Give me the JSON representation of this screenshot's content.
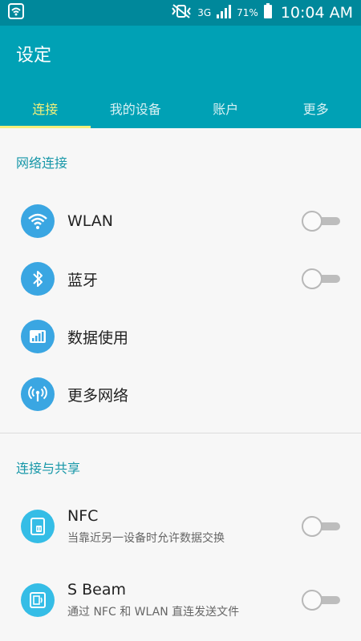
{
  "status_bar": {
    "network": "3G",
    "battery": "71%",
    "time": "10:04 AM"
  },
  "app": {
    "title": "设定",
    "accent": "#00a1b5",
    "tab_indicator": "#f3f07a"
  },
  "tabs": [
    {
      "label": "连接",
      "active": true
    },
    {
      "label": "我的设备",
      "active": false
    },
    {
      "label": "账户",
      "active": false
    },
    {
      "label": "更多",
      "active": false
    }
  ],
  "sections": [
    {
      "header": "网络连接",
      "items": [
        {
          "title": "WLAN",
          "icon": "wifi-icon",
          "toggle": false
        },
        {
          "title": "蓝牙",
          "icon": "bluetooth-icon",
          "toggle": false
        },
        {
          "title": "数据使用",
          "icon": "data-usage-icon"
        },
        {
          "title": "更多网络",
          "icon": "more-networks-icon"
        }
      ]
    },
    {
      "header": "连接与共享",
      "items": [
        {
          "title": "NFC",
          "subtitle": "当靠近另一设备时允许数据交换",
          "icon": "nfc-icon",
          "toggle": false
        },
        {
          "title": "S Beam",
          "subtitle": "通过 NFC 和 WLAN 直连发送文件",
          "icon": "sbeam-icon",
          "toggle": false
        }
      ]
    }
  ]
}
